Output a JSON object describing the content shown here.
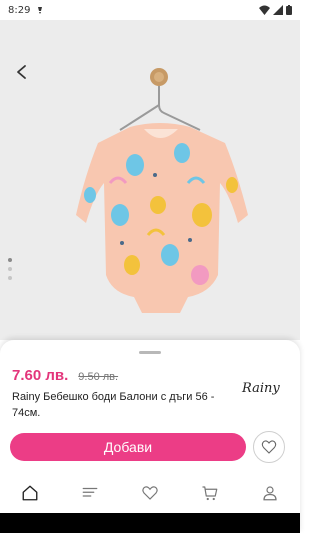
{
  "status": {
    "time": "8:29"
  },
  "product": {
    "price": "7.60 лв.",
    "old_price": "9.50 лв.",
    "title": "Rainy Бебешко боди Балони с дъги 56 - 74см.",
    "brand": "Rainy",
    "image_count": 3,
    "active_image": 1
  },
  "actions": {
    "add_label": "Добави"
  },
  "nav": {
    "items": [
      "home-icon",
      "catalog-icon",
      "favorites-icon",
      "cart-icon",
      "profile-icon"
    ]
  },
  "colors": {
    "accent": "#ec3d86",
    "price": "#e3357b",
    "body_fabric": "#f8c7b0"
  }
}
